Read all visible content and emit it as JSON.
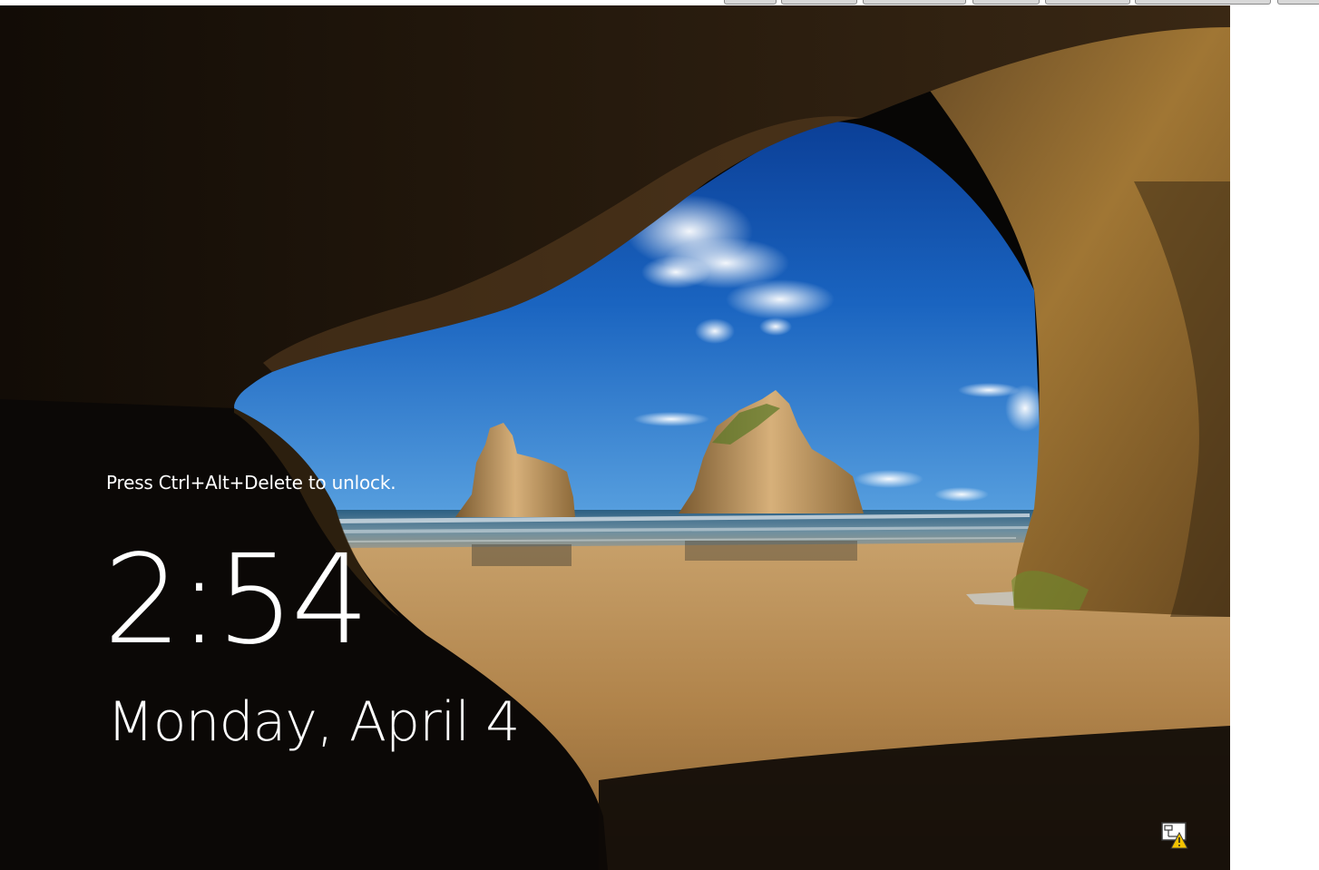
{
  "lock_screen": {
    "unlock_hint": "Press Ctrl+Alt+Delete to unlock.",
    "time": "2:54",
    "date": "Monday, April 4"
  },
  "status_icons": {
    "network": "network-warning-icon"
  },
  "colors": {
    "text": "#ffffff",
    "sky": "#1f6fc4",
    "sand": "#b88a4e",
    "cave": "#070605",
    "warning": "#f2c200"
  }
}
